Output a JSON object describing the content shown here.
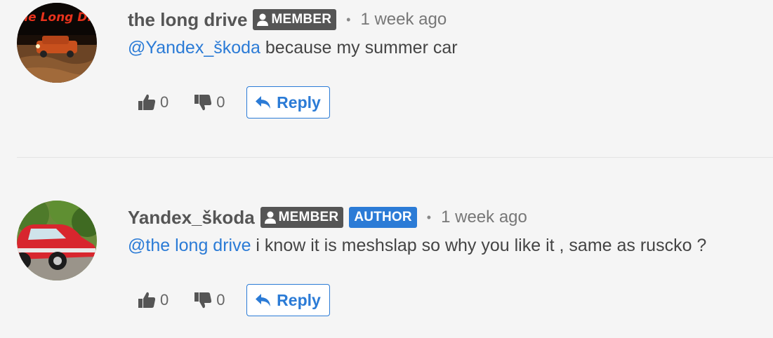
{
  "comments": [
    {
      "username": "the long drive",
      "badges": [
        "MEMBER"
      ],
      "separator": "•",
      "time": "1 week ago",
      "mention": "@Yandex_škoda",
      "text": " because my summer car",
      "likes": "0",
      "dislikes": "0",
      "reply_label": "Reply",
      "avatar_text": "he Long Dr"
    },
    {
      "username": "Yandex_škoda",
      "badges": [
        "MEMBER",
        "AUTHOR"
      ],
      "separator": "•",
      "time": "1 week ago",
      "mention": "@the long drive",
      "text": " i know it is meshslap so why you like it , same as ruscko ?",
      "likes": "0",
      "dislikes": "0",
      "reply_label": "Reply"
    }
  ],
  "colors": {
    "accent": "#2b7bd6",
    "member_badge": "#555555",
    "author_badge": "#2b7bd6"
  },
  "icons": {
    "like": "thumbs-up-icon",
    "dislike": "thumbs-down-icon",
    "reply": "reply-arrow-icon",
    "badge": "user-icon"
  }
}
